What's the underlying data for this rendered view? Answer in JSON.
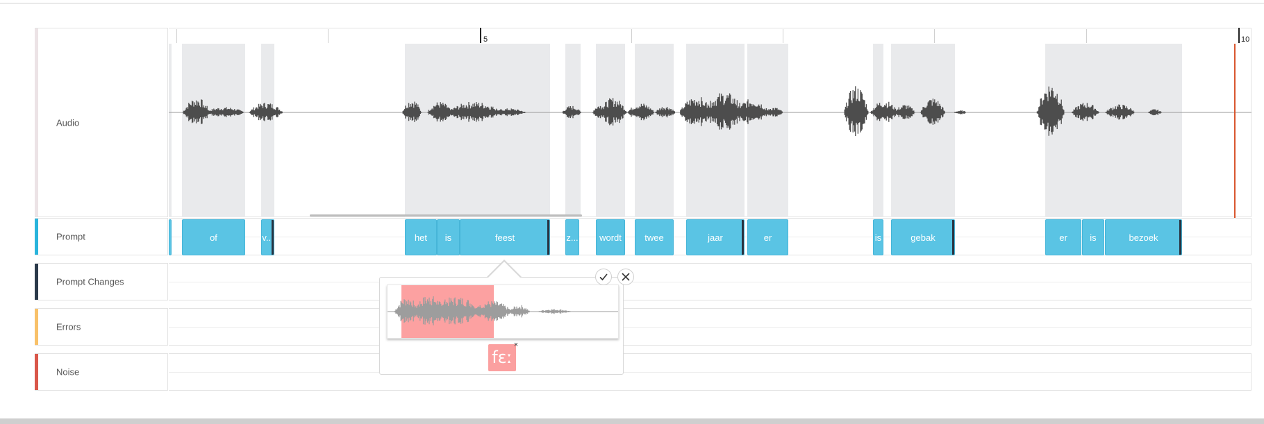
{
  "tracks": {
    "audio": {
      "label": "Audio",
      "color": "#ece3e6"
    },
    "prompt": {
      "label": "Prompt",
      "color": "#29b4dc"
    },
    "prompt_changes": {
      "label": "Prompt Changes",
      "color": "#2b3a4a"
    },
    "errors": {
      "label": "Errors",
      "color": "#f8c169"
    },
    "noise": {
      "label": "Noise",
      "color": "#d9574a"
    }
  },
  "ruler": {
    "label_5": "5",
    "label_10": "10"
  },
  "prompt_segments": [
    {
      "label": "of"
    },
    {
      "label": "v..."
    },
    {
      "label": "het"
    },
    {
      "label": "is"
    },
    {
      "label": "feest"
    },
    {
      "label": "z..."
    },
    {
      "label": "wordt"
    },
    {
      "label": "twee"
    },
    {
      "label": "jaar"
    },
    {
      "label": "er"
    },
    {
      "label": "is"
    },
    {
      "label": "gebak"
    },
    {
      "label": "er"
    },
    {
      "label": "is"
    },
    {
      "label": "bezoek"
    }
  ],
  "popup": {
    "phoneme": "fɛː",
    "remove_symbol": "×",
    "confirm_icon": "check-icon",
    "cancel_icon": "close-icon"
  },
  "colors": {
    "segment": "#5ac4e4",
    "waveform": "#4d4d4d",
    "playhead": "#d8562e",
    "highlight": "#fca1a1"
  }
}
